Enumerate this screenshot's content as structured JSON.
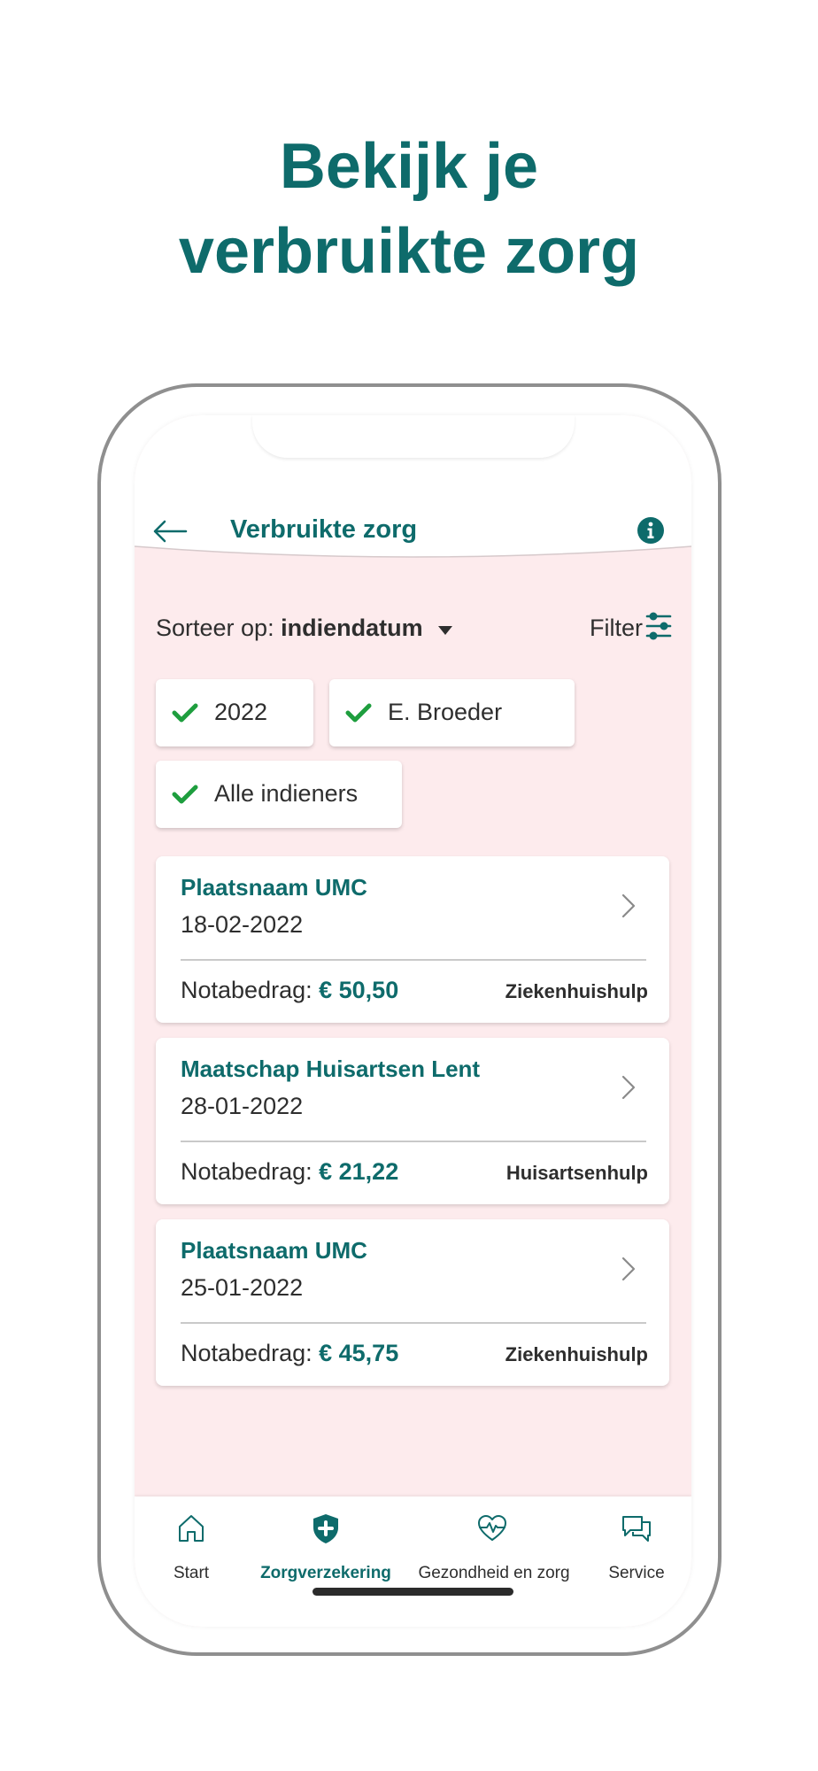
{
  "headline": {
    "line1": "Bekijk je",
    "line2": "verbruikte zorg"
  },
  "appbar": {
    "title": "Verbruikte zorg",
    "back_icon": "arrow-left-icon",
    "info_icon": "info-icon"
  },
  "sort": {
    "label": "Sorteer op:",
    "value": "indiendatum",
    "filter_label": "Filter"
  },
  "chips": [
    {
      "label": "2022"
    },
    {
      "label": "E. Broeder"
    },
    {
      "label": "Alle indieners"
    }
  ],
  "claims": [
    {
      "provider": "Plaatsnaam UMC",
      "date": "18-02-2022",
      "amount_label": "Notabedrag:",
      "amount": "€ 50,50",
      "category": "Ziekenhuishulp"
    },
    {
      "provider": "Maatschap Huisartsen Lent",
      "date": "28-01-2022",
      "amount_label": "Notabedrag:",
      "amount": "€ 21,22",
      "category": "Huisartsenhulp"
    },
    {
      "provider": "Plaatsnaam UMC",
      "date": "25-01-2022",
      "amount_label": "Notabedrag:",
      "amount": "€ 45,75",
      "category": "Ziekenhuishulp"
    }
  ],
  "tabs": [
    {
      "label": "Start",
      "icon": "home-icon"
    },
    {
      "label": "Zorgverzekering",
      "icon": "shield-cross-icon",
      "active": true
    },
    {
      "label": "Gezondheid en zorg",
      "icon": "heart-pulse-icon"
    },
    {
      "label": "Service",
      "icon": "chat-bubbles-icon"
    }
  ],
  "colors": {
    "brand": "#0e6b6b",
    "background": "#fdebed",
    "check": "#1e9e3e"
  }
}
